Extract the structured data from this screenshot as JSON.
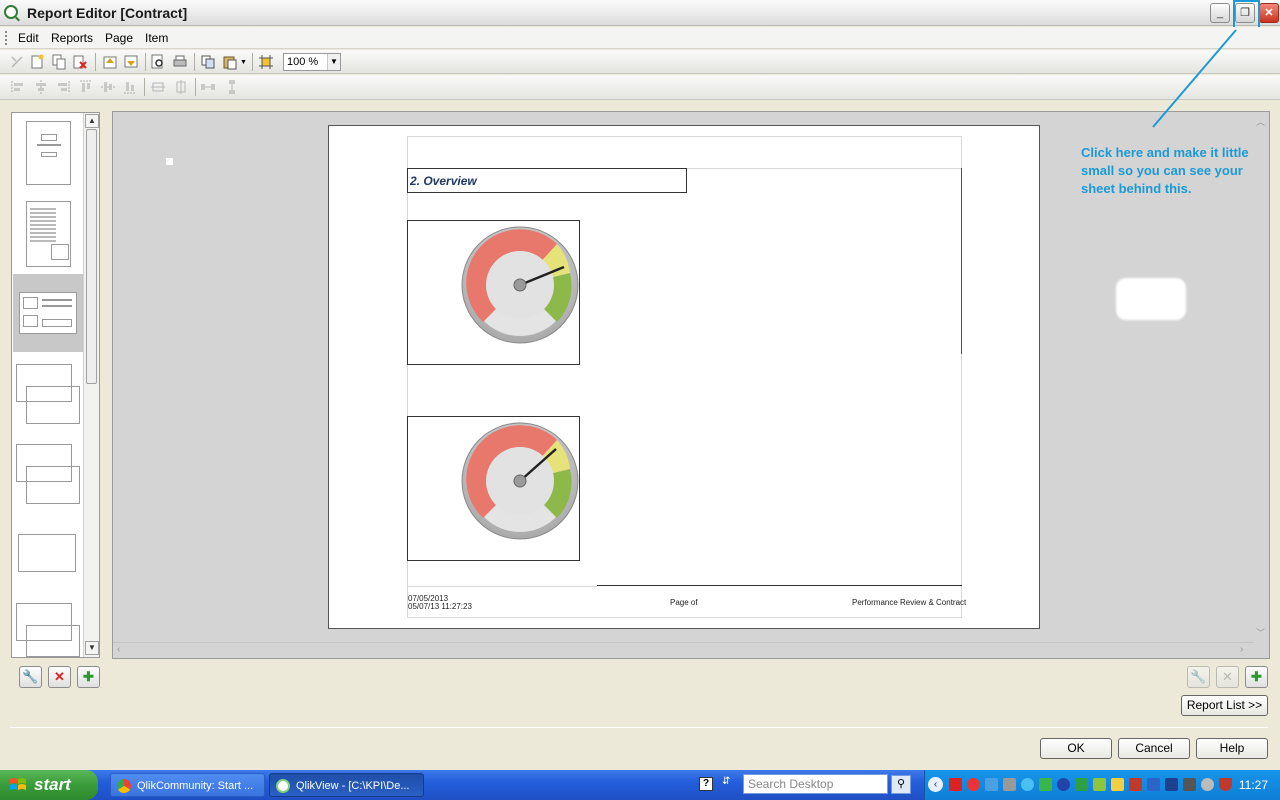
{
  "window": {
    "title": "Report Editor [Contract]",
    "minimize_glyph": "_",
    "restore_glyph": "❐",
    "close_glyph": "✕"
  },
  "menu": {
    "items": [
      "Edit",
      "Reports",
      "Page",
      "Item"
    ]
  },
  "toolbar": {
    "zoom_value": "100 %"
  },
  "page": {
    "section_title": "2. Overview",
    "footer_date": "07/05/2013",
    "footer_datetime": "05/07/13 11:27:23",
    "footer_page": "Page  of",
    "footer_report": "Performance Review & Contract"
  },
  "annotation": {
    "text": "Click here and make it little small so you can see your sheet behind this."
  },
  "buttons": {
    "report_list": "Report List >>",
    "ok": "OK",
    "cancel": "Cancel",
    "help": "Help"
  },
  "taskbar": {
    "start_label": "start",
    "task1": "QlikCommunity: Start ...",
    "task2": "QlikView - [C:\\KPI\\De...",
    "search_placeholder": "Search Desktop",
    "clock": "11:27"
  },
  "colors": {
    "accent_blue": "#1c9ad6",
    "title_navy": "#1f3864",
    "gauge_red": "#e8776c",
    "gauge_yellow": "#e6e27a",
    "gauge_green": "#8db84a"
  }
}
